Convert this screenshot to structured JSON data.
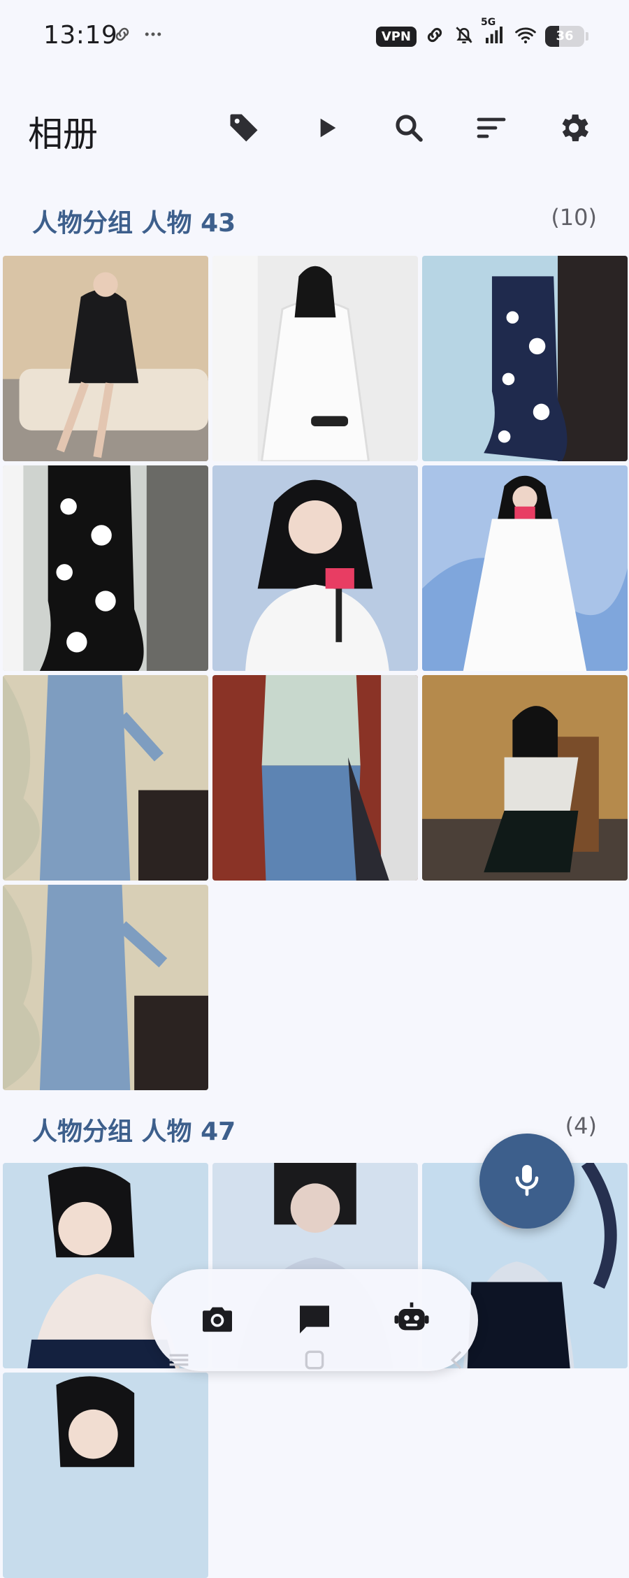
{
  "status_bar": {
    "time": "13:19",
    "vpn": "VPN",
    "network": "5G",
    "battery": "36",
    "battery_level": 0.36,
    "icons": [
      "link-icon",
      "more-icon",
      "link-icon",
      "mute-bell-icon",
      "signal-icon",
      "wifi-icon"
    ]
  },
  "app_bar": {
    "title": "相册",
    "actions": [
      "tag-icon",
      "play-icon",
      "search-icon",
      "sort-icon",
      "settings-icon"
    ]
  },
  "sections": [
    {
      "title": "人物分组 人物 43",
      "count": "(10)",
      "photo_count": 10
    },
    {
      "title": "人物分组 人物 47",
      "count": "(4)",
      "photo_count": 4
    }
  ],
  "fab": {
    "icon": "microphone-icon"
  },
  "bottom_bar": {
    "items": [
      "camera-icon",
      "chat-icon",
      "robot-icon"
    ]
  },
  "colors": {
    "accent": "#3d5f8c",
    "background": "#f6f7fd",
    "text": "#1d1d20"
  }
}
